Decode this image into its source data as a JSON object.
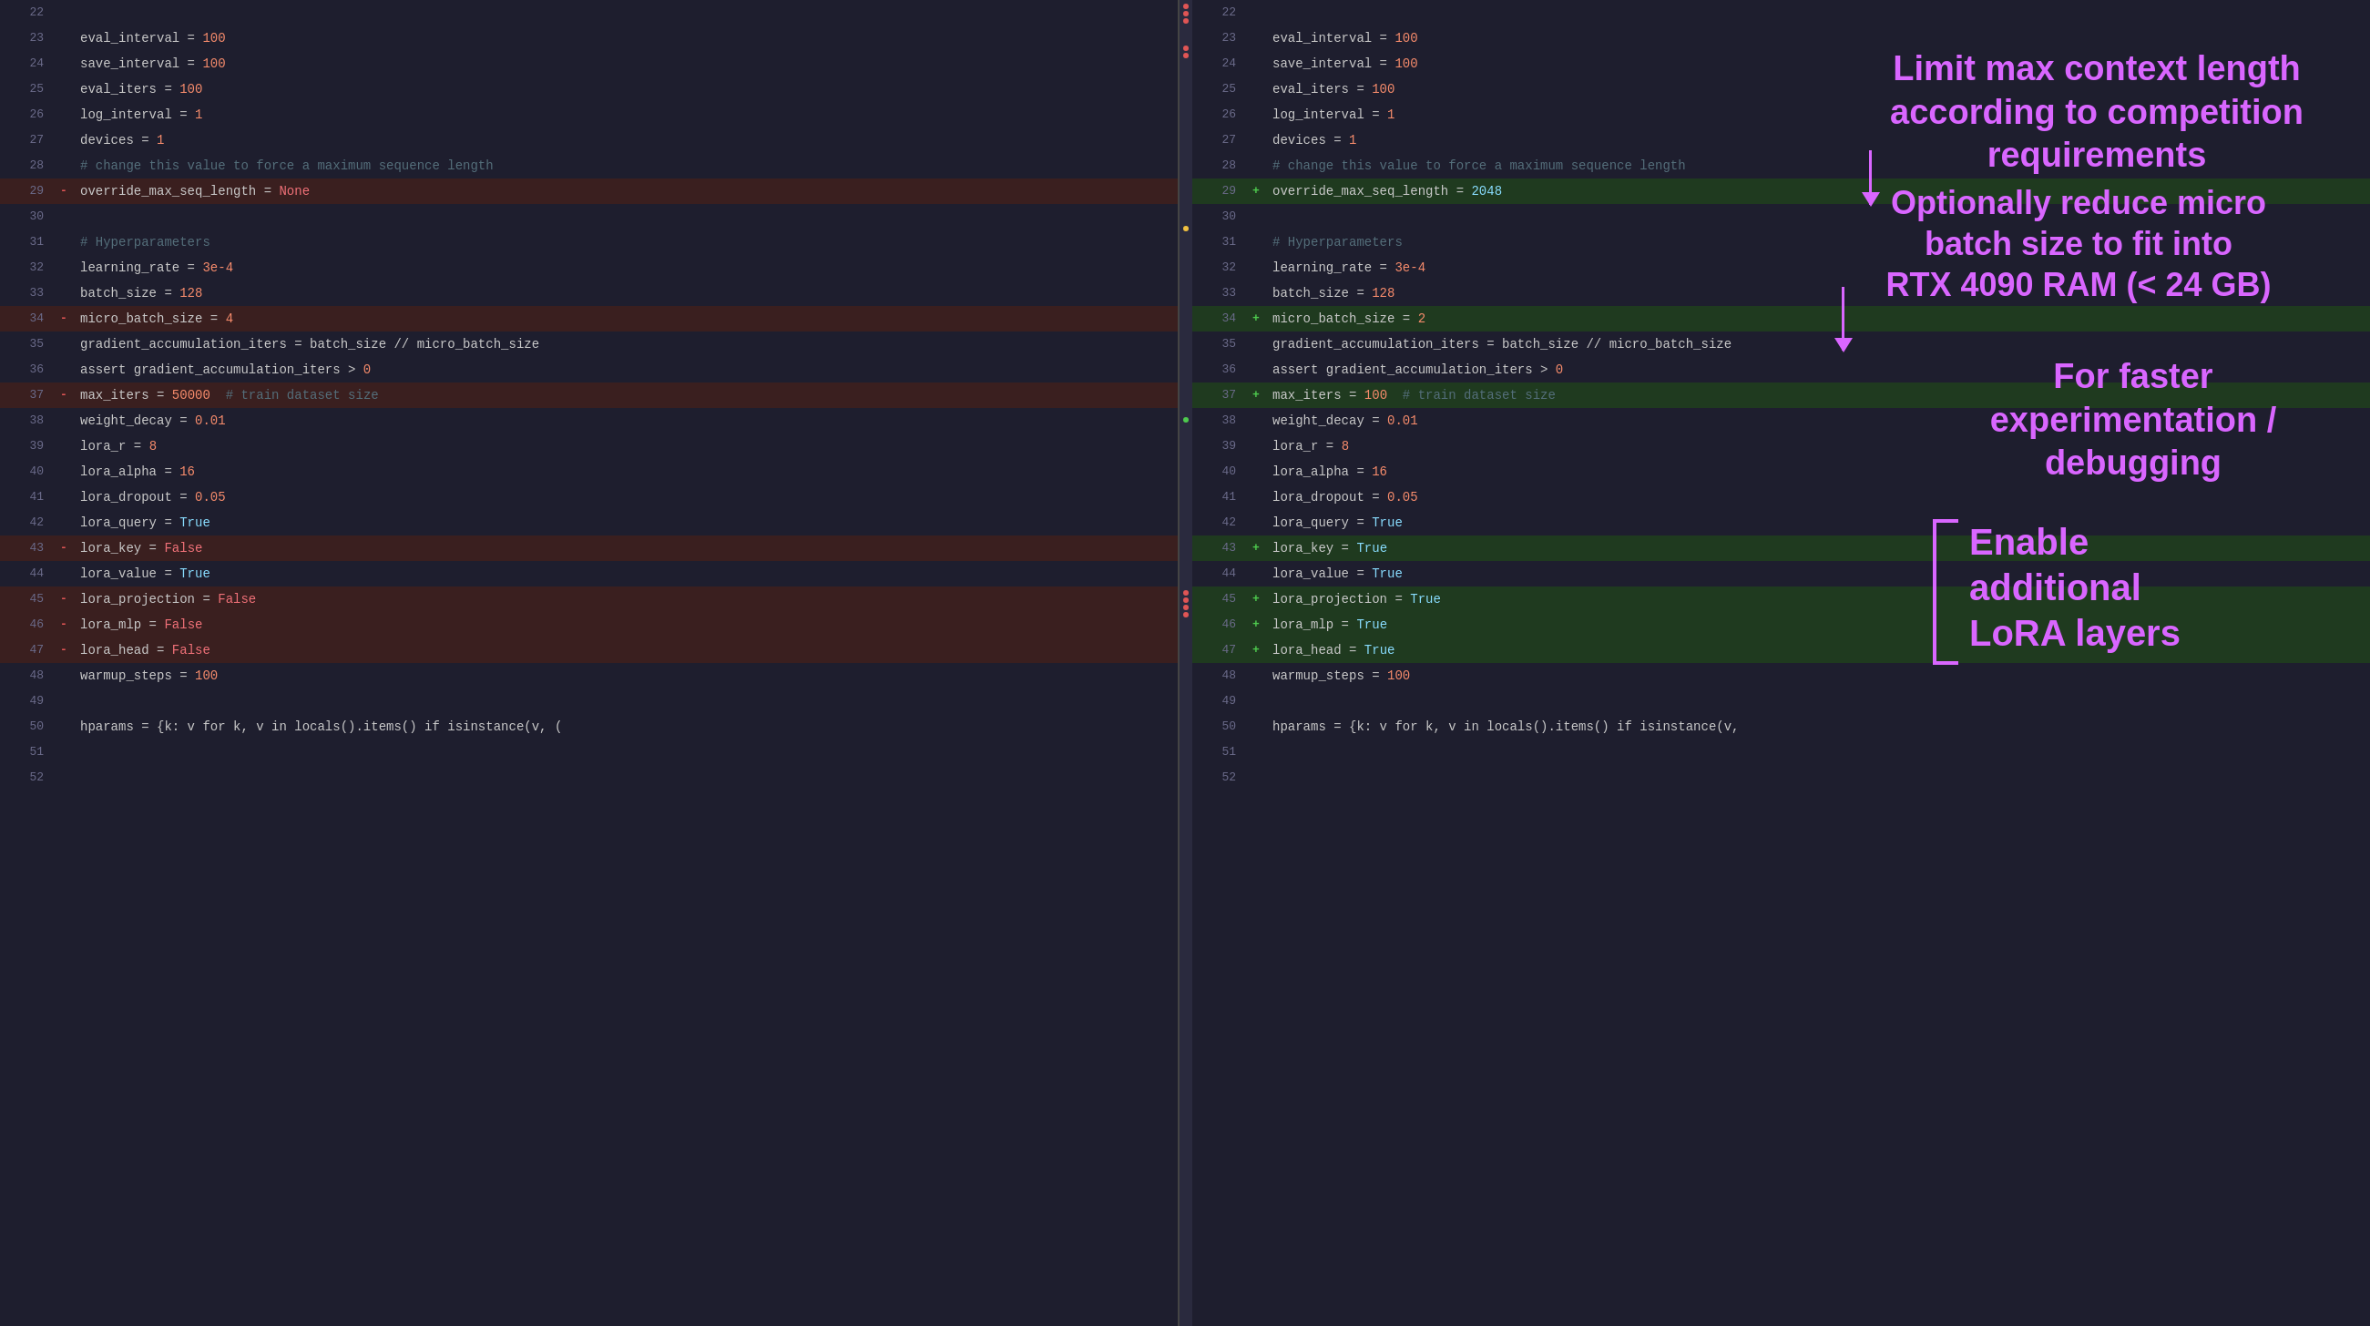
{
  "left_pane": {
    "lines": [
      {
        "num": "22",
        "type": "normal",
        "gutter": "",
        "content": ""
      },
      {
        "num": "23",
        "type": "normal",
        "gutter": "",
        "content_html": "eval_interval = <span class='num'>100</span>"
      },
      {
        "num": "24",
        "type": "normal",
        "gutter": "",
        "content_html": "save_interval = <span class='num'>100</span>"
      },
      {
        "num": "25",
        "type": "normal",
        "gutter": "",
        "content_html": "eval_iters = <span class='num'>100</span>"
      },
      {
        "num": "26",
        "type": "normal",
        "gutter": "",
        "content_html": "log_interval = <span class='num'>1</span>"
      },
      {
        "num": "27",
        "type": "normal",
        "gutter": "",
        "content_html": "devices = <span class='num'>1</span>"
      },
      {
        "num": "28",
        "type": "normal",
        "gutter": "",
        "content_html": "<span class='comment'># change this value to force a maximum sequence length</span>"
      },
      {
        "num": "29",
        "type": "removed",
        "gutter": "-",
        "content_html": "override_max_seq_length = <span class='val-none'>None</span>"
      },
      {
        "num": "30",
        "type": "normal",
        "gutter": "",
        "content_html": ""
      },
      {
        "num": "31",
        "type": "normal",
        "gutter": "",
        "content_html": "<span class='comment'># Hyperparameters</span>"
      },
      {
        "num": "32",
        "type": "normal",
        "gutter": "",
        "content_html": "learning_rate = <span class='num'>3e-4</span>"
      },
      {
        "num": "33",
        "type": "normal",
        "gutter": "",
        "content_html": "batch_size = <span class='num'>128</span>"
      },
      {
        "num": "34",
        "type": "removed",
        "gutter": "-",
        "content_html": "micro_batch_size = <span class='num'>4</span>"
      },
      {
        "num": "35",
        "type": "normal",
        "gutter": "",
        "content_html": "gradient_accumulation_iters = batch_size // micro_batch_size"
      },
      {
        "num": "36",
        "type": "normal",
        "gutter": "",
        "content_html": "assert gradient_accumulation_iters > <span class='num'>0</span>"
      },
      {
        "num": "37",
        "type": "removed",
        "gutter": "-",
        "content_html": "max_iters = <span class='num'>50000</span>  <span class='comment'># train dataset size</span>"
      },
      {
        "num": "38",
        "type": "normal",
        "gutter": "",
        "content_html": "weight_decay = <span class='num'>0.01</span>"
      },
      {
        "num": "39",
        "type": "normal",
        "gutter": "",
        "content_html": "lora_r = <span class='num'>8</span>"
      },
      {
        "num": "40",
        "type": "normal",
        "gutter": "",
        "content_html": "lora_alpha = <span class='num'>16</span>"
      },
      {
        "num": "41",
        "type": "normal",
        "gutter": "",
        "content_html": "lora_dropout = <span class='num'>0.05</span>"
      },
      {
        "num": "42",
        "type": "normal",
        "gutter": "",
        "content_html": "lora_query = <span class='val-true'>True</span>"
      },
      {
        "num": "43",
        "type": "removed",
        "gutter": "-",
        "content_html": "lora_key = <span class='val-false'>False</span>"
      },
      {
        "num": "44",
        "type": "normal",
        "gutter": "",
        "content_html": "lora_value = <span class='val-true'>True</span>"
      },
      {
        "num": "45",
        "type": "removed",
        "gutter": "-",
        "content_html": "lora_projection = <span class='val-false'>False</span>"
      },
      {
        "num": "46",
        "type": "removed",
        "gutter": "-",
        "content_html": "lora_mlp = <span class='val-false'>False</span>"
      },
      {
        "num": "47",
        "type": "removed",
        "gutter": "-",
        "content_html": "lora_head = <span class='val-false'>False</span>"
      },
      {
        "num": "48",
        "type": "normal",
        "gutter": "",
        "content_html": "warmup_steps = <span class='num'>100</span>"
      },
      {
        "num": "49",
        "type": "normal",
        "gutter": "",
        "content_html": ""
      },
      {
        "num": "50",
        "type": "normal",
        "gutter": "",
        "content_html": "hparams = {k: v for k, v in locals().items() if isinstance(v, ("
      },
      {
        "num": "51",
        "type": "normal",
        "gutter": "",
        "content_html": ""
      },
      {
        "num": "52",
        "type": "normal",
        "gutter": "",
        "content_html": ""
      }
    ]
  },
  "right_pane": {
    "lines": [
      {
        "num": "22",
        "type": "normal",
        "gutter": "",
        "content_html": ""
      },
      {
        "num": "23",
        "type": "normal",
        "gutter": "",
        "content_html": "eval_interval = <span class='num'>100</span>"
      },
      {
        "num": "24",
        "type": "normal",
        "gutter": "",
        "content_html": "save_interval = <span class='num'>100</span>"
      },
      {
        "num": "25",
        "type": "normal",
        "gutter": "",
        "content_html": "eval_iters = <span class='num'>100</span>"
      },
      {
        "num": "26",
        "type": "normal",
        "gutter": "",
        "content_html": "log_interval = <span class='num'>1</span>"
      },
      {
        "num": "27",
        "type": "normal",
        "gutter": "",
        "content_html": "devices = <span class='num'>1</span>"
      },
      {
        "num": "28",
        "type": "normal",
        "gutter": "",
        "content_html": "<span class='comment'># change this value to force a maximum sequence length</span>"
      },
      {
        "num": "29",
        "type": "added",
        "gutter": "+",
        "content_html": "override_max_seq_length = <span class='val-true'>2048</span>"
      },
      {
        "num": "30",
        "type": "normal",
        "gutter": "",
        "content_html": ""
      },
      {
        "num": "31",
        "type": "normal",
        "gutter": "",
        "content_html": "<span class='comment'># Hyperparameters</span>"
      },
      {
        "num": "32",
        "type": "normal",
        "gutter": "",
        "content_html": "learning_rate = <span class='num'>3e-4</span>"
      },
      {
        "num": "33",
        "type": "normal",
        "gutter": "",
        "content_html": "batch_size = <span class='num'>128</span>"
      },
      {
        "num": "34",
        "type": "added",
        "gutter": "+",
        "content_html": "micro_batch_size = <span class='num'>2</span>"
      },
      {
        "num": "35",
        "type": "normal",
        "gutter": "",
        "content_html": "gradient_accumulation_iters = batch_size // micro_batch_size"
      },
      {
        "num": "36",
        "type": "normal",
        "gutter": "",
        "content_html": "assert gradient_accumulation_iters > <span class='num'>0</span>"
      },
      {
        "num": "37",
        "type": "added",
        "gutter": "+",
        "content_html": "max_iters = <span class='num'>100</span>  <span class='comment'># train dataset size</span>"
      },
      {
        "num": "38",
        "type": "normal",
        "gutter": "",
        "content_html": "weight_decay = <span class='num'>0.01</span>"
      },
      {
        "num": "39",
        "type": "normal",
        "gutter": "",
        "content_html": "lora_r = <span class='num'>8</span>"
      },
      {
        "num": "40",
        "type": "normal",
        "gutter": "",
        "content_html": "lora_alpha = <span class='num'>16</span>"
      },
      {
        "num": "41",
        "type": "normal",
        "gutter": "",
        "content_html": "lora_dropout = <span class='num'>0.05</span>"
      },
      {
        "num": "42",
        "type": "normal",
        "gutter": "",
        "content_html": "lora_query = <span class='val-true'>True</span>"
      },
      {
        "num": "43",
        "type": "added",
        "gutter": "+",
        "content_html": "lora_key = <span class='val-true'>True</span>"
      },
      {
        "num": "44",
        "type": "normal",
        "gutter": "",
        "content_html": "lora_value = <span class='val-true'>True</span>"
      },
      {
        "num": "45",
        "type": "added",
        "gutter": "+",
        "content_html": "lora_projection = <span class='val-true'>True</span>"
      },
      {
        "num": "46",
        "type": "added",
        "gutter": "+",
        "content_html": "lora_mlp = <span class='val-true'>True</span>"
      },
      {
        "num": "47",
        "type": "added",
        "gutter": "+",
        "content_html": "lora_head = <span class='val-true'>True</span>"
      },
      {
        "num": "48",
        "type": "normal",
        "gutter": "",
        "content_html": "warmup_steps = <span class='num'>100</span>"
      },
      {
        "num": "49",
        "type": "normal",
        "gutter": "",
        "content_html": ""
      },
      {
        "num": "50",
        "type": "normal",
        "gutter": "",
        "content_html": "hparams = {k: v for k, v in locals().items() if isinstance(v,"
      },
      {
        "num": "51",
        "type": "normal",
        "gutter": "",
        "content_html": ""
      },
      {
        "num": "52",
        "type": "normal",
        "gutter": "",
        "content_html": ""
      }
    ]
  },
  "annotations": {
    "ann1": {
      "text": "Limit max context length\naccording to competition\nrequirements",
      "color": "#d966ff"
    },
    "ann2": {
      "text": "Optionally reduce micro\nbatch size to fit into\nRTX 4090 RAM (< 24 GB)",
      "color": "#d966ff"
    },
    "ann3": {
      "text": "For faster\nexperimentation /\ndebugging",
      "color": "#d966ff"
    },
    "ann4": {
      "text": "Enable\nadditional\nLoRA layers",
      "color": "#d966ff"
    }
  }
}
